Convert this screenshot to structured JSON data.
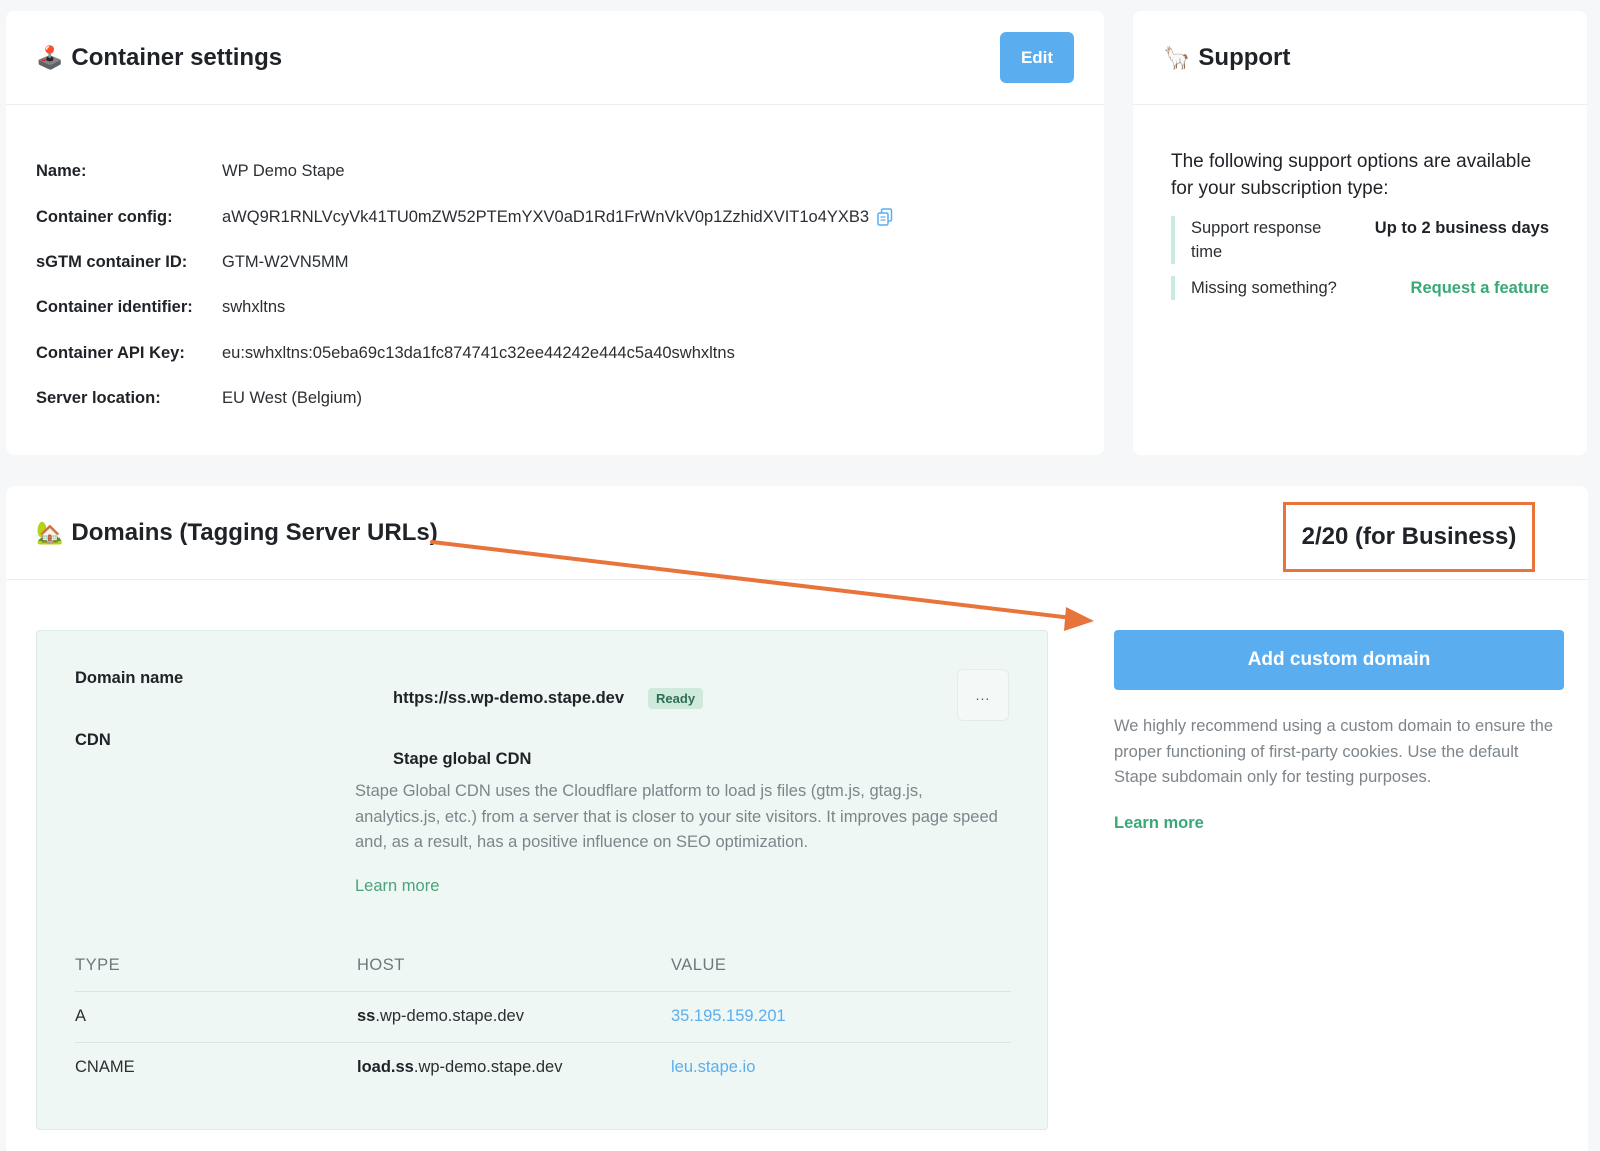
{
  "settings": {
    "title": "Container settings",
    "title_icon": "joystick-icon",
    "edit_label": "Edit",
    "fields": [
      {
        "key": "Name:",
        "value": "WP Demo Stape"
      },
      {
        "key": "Container config:",
        "value": "aWQ9R1RNLVcyVk41TU0mZW52PTEmYXV0aD1Rd1FrWnVkV0p1ZzhidXVIT1o4YXB3"
      },
      {
        "key": "sGTM container ID:",
        "value": "GTM-W2VN5MM"
      },
      {
        "key": "Container identifier:",
        "value": "swhxltns"
      },
      {
        "key": "Container API Key:",
        "value": "eu:swhxltns:05eba69c13da1fc874741c32ee44242e444c5a40swhxltns"
      },
      {
        "key": "Server location:",
        "value": "EU West (Belgium)"
      }
    ]
  },
  "support": {
    "title": "Support",
    "title_icon": "llama-icon",
    "intro": "The following support options are available for your subscription type:",
    "rows": [
      {
        "label": "Support response time",
        "value": "Up to 2 business days"
      },
      {
        "label": "Missing something?",
        "value": "Request a feature"
      }
    ]
  },
  "domains": {
    "title": "Domains (Tagging Server URLs)",
    "title_icon": "house-tree-icon",
    "quota": "2/20 (for Business)",
    "domain_name_label": "Domain name",
    "domain_name_value": "https://ss.wp-demo.stape.dev",
    "status_badge": "Ready",
    "more_label": "...",
    "cdn_label": "CDN",
    "cdn_value": "Stape global CDN",
    "cdn_description": "Stape Global CDN uses the Cloudflare platform to load js files (gtm.js, gtag.js, analytics.js, etc.) from a server that is closer to your site visitors. It improves page speed and, as a result, has a positive influence on SEO optimization.",
    "cdn_learn_more": "Learn more",
    "dns_headers": [
      "TYPE",
      "HOST",
      "VALUE"
    ],
    "dns_records": [
      {
        "type": "A",
        "host_bold": "ss",
        "host_rest": ".wp-demo.stape.dev",
        "value": "35.195.159.201"
      },
      {
        "type": "CNAME",
        "host_bold": "load.ss",
        "host_rest": ".wp-demo.stape.dev",
        "value": "leu.stape.io"
      }
    ],
    "add_button": "Add custom domain",
    "hint": "We highly recommend using a custom domain to ensure the proper functioning of first-party cookies. Use the default Stape subdomain only for testing purposes.",
    "hint_learn_more": "Learn more"
  },
  "annotation": {
    "arrow_color": "#e8743b",
    "box_color": "#e8743b"
  }
}
